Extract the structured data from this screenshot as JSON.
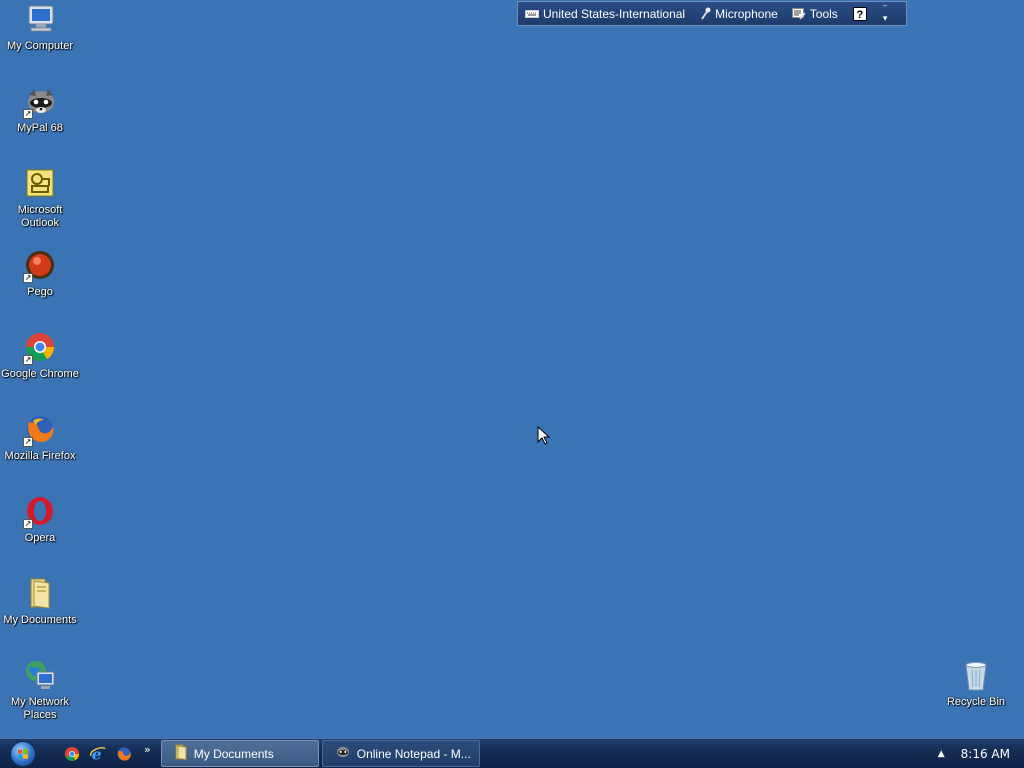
{
  "desktop": {
    "icons": [
      {
        "label": "My Computer",
        "icon": "computer-icon"
      },
      {
        "label": "MyPal 68",
        "icon": "mypal-icon"
      },
      {
        "label": "Microsoft Outlook",
        "icon": "outlook-icon"
      },
      {
        "label": "Pego",
        "icon": "pego-icon"
      },
      {
        "label": "Google Chrome",
        "icon": "chrome-icon"
      },
      {
        "label": "Mozilla Firefox",
        "icon": "firefox-icon"
      },
      {
        "label": "Opera",
        "icon": "opera-icon"
      },
      {
        "label": "My Documents",
        "icon": "folder-icon"
      },
      {
        "label": "My Network Places",
        "icon": "network-icon"
      },
      {
        "label": "Recycle Bin",
        "icon": "recycle-bin-icon"
      }
    ]
  },
  "langbar": {
    "language": "United States-International",
    "microphone": "Microphone",
    "tools": "Tools",
    "help": "?"
  },
  "taskbar": {
    "tasks": [
      {
        "label": "My Documents",
        "icon": "folder-icon"
      },
      {
        "label": "Online Notepad - M...",
        "icon": "mypal-icon"
      }
    ],
    "quicklaunch_more": "»",
    "clock": "8:16 AM"
  },
  "colors": {
    "desktop": "#3b74b4",
    "taskbar": "#142b52"
  }
}
